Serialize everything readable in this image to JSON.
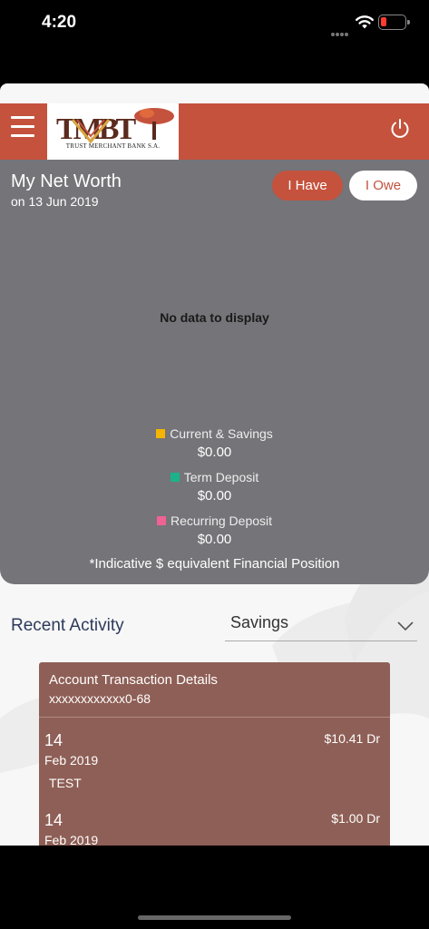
{
  "status_bar": {
    "time": "4:20"
  },
  "header": {
    "logo_caption": "TRUST MERCHANT BANK S.A."
  },
  "net_worth": {
    "title": "My Net Worth",
    "date": "on 13 Jun 2019",
    "btn_have": "I Have",
    "btn_owe": "I Owe",
    "no_data": "No data to display",
    "legend": [
      {
        "label": "Current & Savings",
        "value": "$0.00",
        "color": "#f5b400"
      },
      {
        "label": "Term Deposit",
        "value": "$0.00",
        "color": "#1bb38a"
      },
      {
        "label": "Recurring Deposit",
        "value": "$0.00",
        "color": "#f06292"
      }
    ],
    "footnote": "*Indicative $ equivalent Financial Position"
  },
  "recent": {
    "title": "Recent Activity",
    "account_type": "Savings",
    "card_title": "Account Transaction Details",
    "account_number": "xxxxxxxxxxxx0-68",
    "transactions": [
      {
        "day": "14",
        "month": "Feb 2019",
        "desc": "TEST",
        "amount": "$10.41 Dr"
      },
      {
        "day": "14",
        "month": "Feb 2019",
        "desc": "",
        "amount": "$1.00 Dr"
      }
    ]
  },
  "colors": {
    "brand": "#c4523d",
    "card": "#747479",
    "txn_card": "#8e5f56"
  }
}
